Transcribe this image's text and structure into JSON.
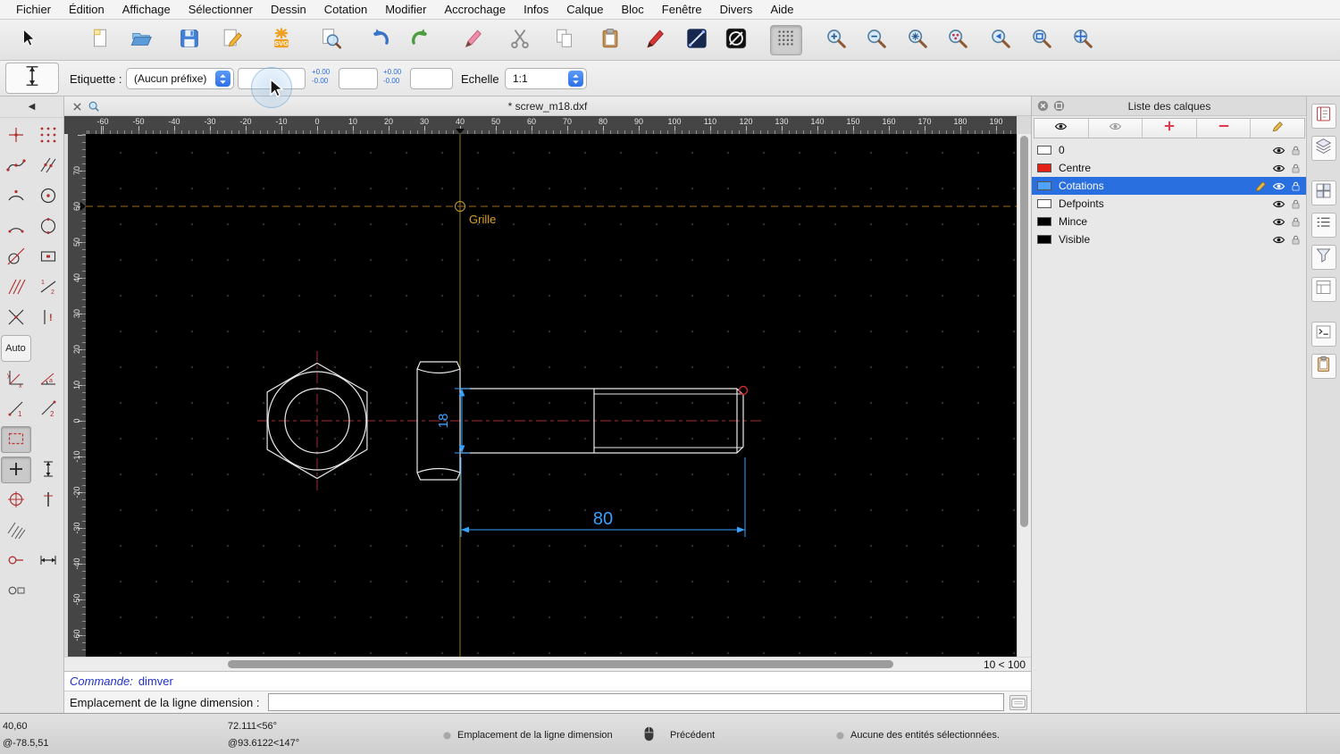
{
  "menu_bar": {
    "items": [
      "Fichier",
      "Édition",
      "Affichage",
      "Sélectionner",
      "Dessin",
      "Cotation",
      "Modifier",
      "Accrochage",
      "Infos",
      "Calque",
      "Bloc",
      "Fenêtre",
      "Divers",
      "Aide"
    ]
  },
  "toolbar_main": {
    "buttons": [
      "selection-cursor",
      "new-document",
      "open-file",
      "save-file",
      "edit-document",
      "export-svg",
      "print-preview",
      "undo",
      "redo",
      "highlight-pen",
      "cut",
      "copy",
      "paste",
      "draw-pen",
      "line-attributes",
      "entity-options",
      "grid-toggle",
      "zoom-in",
      "zoom-out",
      "zoom-auto",
      "zoom-points",
      "zoom-previous",
      "zoom-window",
      "zoom-pan"
    ]
  },
  "tool_options": {
    "current_tool": "dimension-vertical",
    "label_field_label": "Etiquette :",
    "prefix_selected": "(Aucun préfixe)",
    "label_value": "",
    "tolerance_upper": "+0.00",
    "tolerance_lower": "-0.00",
    "scale_label": "Echelle",
    "scale_value": "1:1"
  },
  "left_toolbar": {
    "auto_label": "Auto",
    "tools": [
      "snap-free",
      "snap-grid",
      "snap-endpoint",
      "snap-on-entity",
      "snap-arc",
      "snap-circle",
      "snap-arc-point",
      "snap-circle-point",
      "snap-tangent",
      "snap-rectangle",
      "snap-hatch",
      "snap-divide",
      "snap-cross",
      "snap-exclusive",
      "auto",
      "",
      "coord-cartesian",
      "coord-polar",
      "dim-first",
      "dim-second",
      "selection-window",
      "",
      "snap-plus",
      "dim-vertical",
      "snap-circle-cross",
      "restrict-vertical",
      "hatch-lines",
      "",
      "relative-zero",
      "dim-horizontal",
      "relative-zero-lock",
      ""
    ]
  },
  "document_tab": {
    "title": "* screw_m18.dxf"
  },
  "rulers": {
    "top": [
      "-60",
      "-50",
      "-40",
      "-30",
      "-20",
      "-10",
      "0",
      "10",
      "20",
      "30",
      "40",
      "50",
      "60",
      "70",
      "80",
      "90",
      "100",
      "110",
      "120",
      "130",
      "140",
      "150",
      "160",
      "170",
      "180",
      "190"
    ],
    "left": [
      "70",
      "60",
      "50",
      "40",
      "30",
      "20",
      "10",
      "0",
      "-10",
      "-20",
      "-30",
      "-40",
      "-50",
      "-60"
    ]
  },
  "canvas": {
    "grid_point_label": "Grille",
    "dimensions": {
      "vertical": "18",
      "horizontal": "80"
    },
    "zoom_range": "10 < 100",
    "colors": {
      "background": "#000000",
      "geometry": "#e8e8e8",
      "centerline": "#a03030",
      "dimension": "#36a2ff",
      "grid_axis": "#8f7d33",
      "grid_label": "#d9a21b"
    }
  },
  "layers_panel": {
    "title": "Liste des calques",
    "toolbar": [
      "show-all-layers",
      "hide-all-layers",
      "add-layer",
      "remove-layer",
      "edit-layer"
    ],
    "layers": [
      {
        "name": "0",
        "color": "#ffffff",
        "selected": false
      },
      {
        "name": "Centre",
        "color": "#e32119",
        "selected": false
      },
      {
        "name": "Cotations",
        "color": "#4da3ff",
        "selected": true
      },
      {
        "name": "Defpoints",
        "color": "#ffffff",
        "selected": false
      },
      {
        "name": "Mince",
        "color": "#000000",
        "selected": false
      },
      {
        "name": "Visible",
        "color": "#000000",
        "selected": false
      }
    ]
  },
  "right_dock": {
    "panels": [
      "library-browser",
      "layer-panel",
      "block-panel",
      "view-list",
      "selection-filter",
      "property-editor",
      "command-line-panel",
      "clipboard-panel"
    ]
  },
  "command_area": {
    "history_label": "Commande:",
    "history_value": "dimver",
    "prompt_label": "Emplacement de la ligne dimension :",
    "prompt_value": ""
  },
  "status_bar": {
    "absolute_coordinates": "40,60",
    "relative_coordinates": "@-78.5,51",
    "absolute_polar": "72.111<56°",
    "relative_polar": "@93.6122<147°",
    "left_button_hint": "Emplacement de la ligne dimension",
    "right_button_hint": "Précédent",
    "selection_status": "Aucune des entités sélectionnées."
  }
}
